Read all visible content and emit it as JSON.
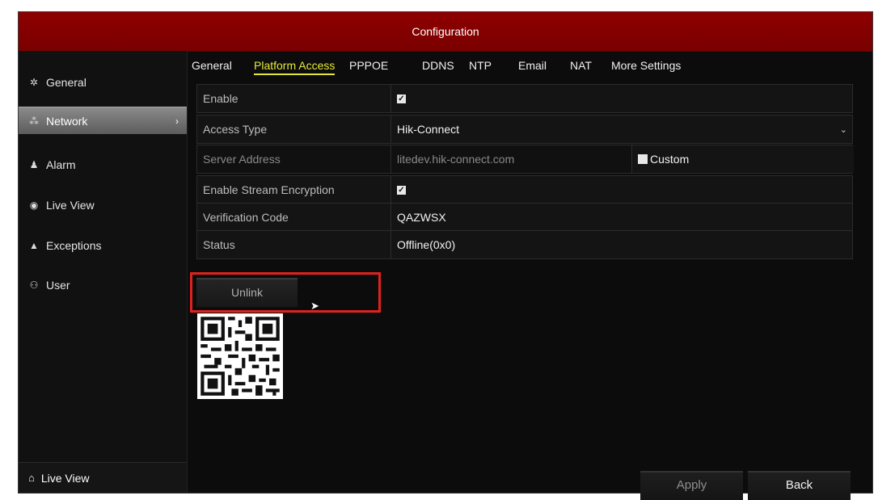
{
  "window": {
    "title": "Configuration"
  },
  "sidebar": {
    "items": [
      {
        "label": "General",
        "icon": "gear-icon"
      },
      {
        "label": "Network",
        "icon": "network-icon",
        "active": true
      },
      {
        "label": "Alarm",
        "icon": "alarm-icon"
      },
      {
        "label": "Live View",
        "icon": "eye-icon"
      },
      {
        "label": "Exceptions",
        "icon": "warning-icon"
      },
      {
        "label": "User",
        "icon": "user-icon"
      }
    ],
    "bottom": {
      "label": "Live View",
      "icon": "home-icon"
    }
  },
  "tabs": [
    "General",
    "Platform Access",
    "PPPOE",
    "DDNS",
    "NTP",
    "Email",
    "NAT",
    "More Settings"
  ],
  "active_tab": "Platform Access",
  "form": {
    "enable": {
      "label": "Enable",
      "checked": true
    },
    "access_type": {
      "label": "Access Type",
      "value": "Hik-Connect"
    },
    "server_address": {
      "label": "Server Address",
      "value": "litedev.hik-connect.com",
      "custom_label": "Custom",
      "custom_checked": false
    },
    "stream_encryption": {
      "label": "Enable Stream Encryption",
      "checked": true
    },
    "verification_code": {
      "label": "Verification Code",
      "value": "QAZWSX"
    },
    "status": {
      "label": "Status",
      "value": "Offline(0x0)"
    }
  },
  "unlink_label": "Unlink",
  "buttons": {
    "apply": "Apply",
    "back": "Back"
  },
  "colors": {
    "titlebar": "#8e0000",
    "active_tab": "#e5e83a",
    "highlight": "#e0221e"
  }
}
